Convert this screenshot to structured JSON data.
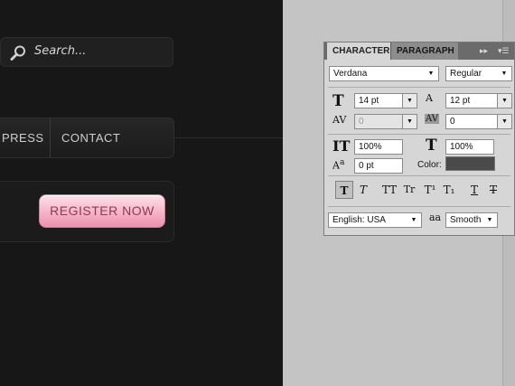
{
  "canvas": {
    "search_placeholder": "Search...",
    "nav_items": [
      "PRESS",
      "CONTACT"
    ],
    "register_label": "REGISTER NOW"
  },
  "panel": {
    "tabs": [
      "CHARACTER",
      "PARAGRAPH"
    ],
    "font_family": "Verdana",
    "font_style": "Regular",
    "font_size": "14 pt",
    "leading": "12 pt",
    "kerning": "0",
    "tracking": "0",
    "vertical_scale": "100%",
    "horizontal_scale": "100%",
    "baseline_shift": "0 pt",
    "color_label": "Color:",
    "color_value": "#4a4a4a",
    "language": "English: USA",
    "antialias_icon_text": "aa",
    "antialias": "Smooth",
    "style_buttons": [
      "T",
      "T",
      "TT",
      "Tr",
      "T¹",
      "T₁",
      "T",
      "T"
    ]
  }
}
